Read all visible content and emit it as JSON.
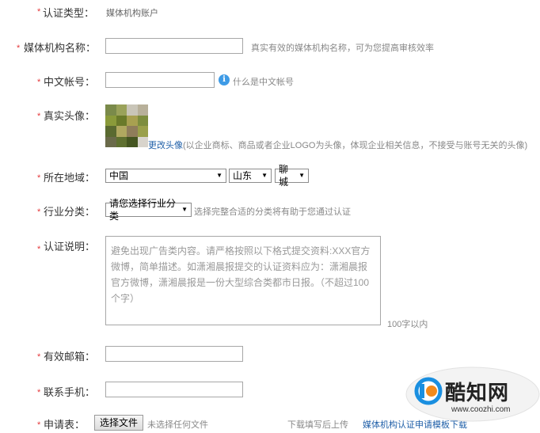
{
  "form": {
    "required_mark": "*",
    "account_type": {
      "label": "认证类型：",
      "value": "媒体机构账户"
    },
    "org_name": {
      "label": "媒体机构名称：",
      "value": "",
      "hint": "真实有效的媒体机构名称，可为您提高审核效率"
    },
    "chinese_account": {
      "label": "中文帐号：",
      "value": "",
      "info_icon": "i",
      "hint": "什么是中文帐号"
    },
    "avatar": {
      "label": "真实头像：",
      "change_link": "更改头像",
      "hint": "(以企业商标、商品或者企业LOGO为头像，体现企业相关信息，不接受与账号无关的头像)"
    },
    "location": {
      "label": "所在地域：",
      "country": "中国",
      "province": "山东",
      "city": "聊城"
    },
    "industry": {
      "label": "行业分类：",
      "selected": "请您选择行业分类",
      "hint": "选择完整合适的分类将有助于您通过认证"
    },
    "description": {
      "label": "认证说明：",
      "placeholder": "避免出现广告类内容。请严格按照以下格式提交资料:XXX官方微博，简单描述。如潇湘晨报提交的认证资料应为：潇湘晨报官方微博，潇湘晨报是一份大型综合类都市日报。（不超过100个字）",
      "limit": "100字以内"
    },
    "email": {
      "label": "有效邮箱：",
      "value": ""
    },
    "phone": {
      "label": "联系手机：",
      "value": ""
    },
    "application": {
      "label": "申请表：",
      "choose_file": "选择文件",
      "no_file": "未选择任何文件",
      "download_hint": "下载填写后上传",
      "template_link": "媒体机构认证申请模板下载"
    }
  },
  "watermark": {
    "brand": "酷知网",
    "url": "www.coozhi.com"
  },
  "colors": {
    "required": "#e4393c",
    "link": "#1f5fa8",
    "info": "#3e9be6",
    "border": "#a7a7a7"
  }
}
